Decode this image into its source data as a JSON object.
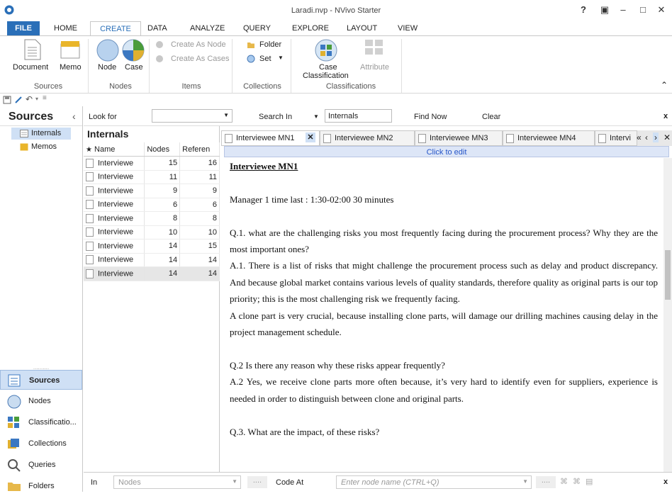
{
  "window": {
    "title": "Laradi.nvp - NVivo Starter",
    "help": "?",
    "close_label": "x"
  },
  "menu": {
    "tabs": [
      {
        "label": "FILE"
      },
      {
        "label": "HOME"
      },
      {
        "label": "CREATE"
      },
      {
        "label": "DATA"
      },
      {
        "label": "ANALYZE"
      },
      {
        "label": "QUERY"
      },
      {
        "label": "EXPLORE"
      },
      {
        "label": "LAYOUT"
      },
      {
        "label": "VIEW"
      }
    ]
  },
  "ribbon": {
    "document": "Document",
    "memo": "Memo",
    "sources_group": "Sources",
    "node": "Node",
    "case": "Case",
    "nodes_group": "Nodes",
    "create_as_node": "Create As Node",
    "create_as_cases": "Create As Cases",
    "items_group": "Items",
    "folder": "Folder",
    "set": "Set",
    "collections_group": "Collections",
    "case_classification_1": "Case",
    "case_classification_2": "Classification",
    "attribute": "Attribute",
    "classifications_group": "Classifications"
  },
  "nav": {
    "header": "Sources",
    "tree": [
      {
        "label": "Internals"
      },
      {
        "label": "Memos"
      }
    ],
    "sections": [
      {
        "label": "Sources"
      },
      {
        "label": "Nodes"
      },
      {
        "label": "Classificatio..."
      },
      {
        "label": "Collections"
      },
      {
        "label": "Queries"
      },
      {
        "label": "Folders"
      }
    ]
  },
  "search": {
    "look_for": "Look for",
    "search_in": "Search In",
    "search_in_value": "Internals",
    "find_now": "Find Now",
    "clear": "Clear"
  },
  "list": {
    "title": "Internals",
    "columns": [
      "Name",
      "Nodes",
      "Referen"
    ],
    "rows": [
      {
        "name": "Interviewe",
        "nodes": "15",
        "refs": "16"
      },
      {
        "name": "Interviewe",
        "nodes": "11",
        "refs": "11"
      },
      {
        "name": "Interviewe",
        "nodes": "9",
        "refs": "9"
      },
      {
        "name": "Interviewe",
        "nodes": "6",
        "refs": "6"
      },
      {
        "name": "Interviewe",
        "nodes": "8",
        "refs": "8"
      },
      {
        "name": "Interviewe",
        "nodes": "10",
        "refs": "10"
      },
      {
        "name": "Interviewe",
        "nodes": "14",
        "refs": "15"
      },
      {
        "name": "Interviewe",
        "nodes": "14",
        "refs": "14"
      },
      {
        "name": "Interviewe",
        "nodes": "14",
        "refs": "14"
      }
    ]
  },
  "doc_tabs": [
    {
      "label": "Interviewee MN1"
    },
    {
      "label": "Interviewee MN2"
    },
    {
      "label": "Interviewee MN3"
    },
    {
      "label": "Interviewee MN4"
    },
    {
      "label": "Intervi"
    }
  ],
  "click_to_edit": "Click to edit",
  "document": {
    "title": "Interviewee MN1",
    "paragraphs": [
      "Manager 1 time last : 1:30-02:00  30 minutes",
      "Q.1. what are the challenging risks you most frequently facing during the procurement process? Why they are the most important ones?",
      "A.1. There is a list of risks that might challenge the procurement process such as delay and product discrepancy.  And because global market contains various levels of quality standards, therefore quality as original parts is our top priority; this is the most challenging risk we frequently facing.",
      "A clone part is very crucial, because installing clone parts, will damage our drilling machines causing delay in the project management schedule.",
      "Q.2 Is there any reason why these risks appear frequently?",
      " A.2 Yes, we receive clone parts more often because, it’s very hard to identify even for suppliers, experience is needed in order to distinguish between clone and original parts.",
      "Q.3. What are the impact, of these risks?"
    ]
  },
  "bottom": {
    "in": "In",
    "nodes": "Nodes",
    "dots": "....",
    "code_at": "Code At",
    "placeholder": "Enter node name (CTRL+Q)"
  },
  "colors": {
    "accent": "#2a6fb8",
    "nav_selected": "#cfe0f5"
  }
}
